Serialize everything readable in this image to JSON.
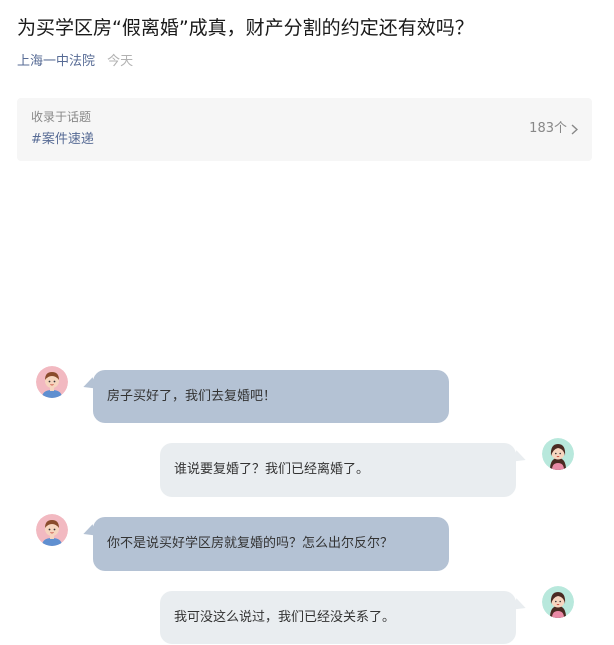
{
  "article": {
    "title": "为买学区房“假离婚”成真，财产分割的约定还有效吗？",
    "author": "上海一中法院",
    "date": "今天"
  },
  "topic": {
    "label": "收录于话题",
    "tag": "#案件速递",
    "count": "183个"
  },
  "chat": [
    {
      "side": "left",
      "avatar": "boy-avatar",
      "text": "房子买好了，我们去复婚吧！"
    },
    {
      "side": "right",
      "avatar": "girl-avatar",
      "text": "谁说要复婚了？我们已经离婚了。"
    },
    {
      "side": "left",
      "avatar": "boy-avatar",
      "text": "你不是说买好学区房就复婚的吗？怎么出尔反尔？"
    },
    {
      "side": "right",
      "avatar": "girl-avatar",
      "text": "我可没这么说过，我们已经没关系了。"
    }
  ],
  "icons": {
    "topic_arrow": "chevron-right-icon",
    "boy": "boy-avatar-icon",
    "girl": "girl-avatar-icon"
  },
  "colors": {
    "link": "#576b95",
    "bubble_left": "#b4c2d4",
    "bubble_right": "#e9edf0"
  }
}
